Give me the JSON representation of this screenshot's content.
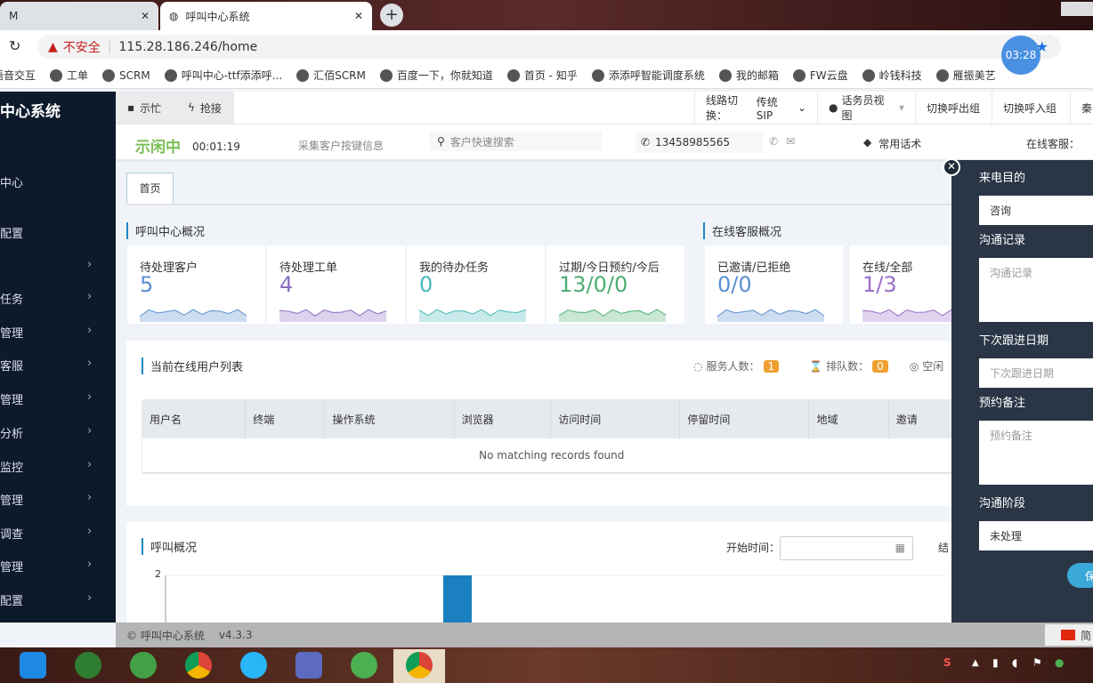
{
  "browser": {
    "tabs": [
      {
        "title": "M"
      },
      {
        "title": "呼叫中心系统"
      }
    ],
    "security": "不安全",
    "url": "115.28.186.246/home",
    "timer": "03:28",
    "bookmarks": [
      "语音交互",
      "工单",
      "SCRM",
      "呼叫中心-ttf添添呼...",
      "汇佰SCRM",
      "百度一下，你就知道",
      "首页 - 知乎",
      "添添呼智能调度系统",
      "我的邮箱",
      "FW云盘",
      "岭钱科技",
      "雁振美艺"
    ]
  },
  "sidebar": {
    "title": "中心系统",
    "items": [
      {
        "label": "中心",
        "chev": false
      },
      {
        "label": "配置",
        "chev": false
      },
      {
        "label": "",
        "chev": true
      },
      {
        "label": "任务",
        "chev": true
      },
      {
        "label": "管理",
        "chev": true
      },
      {
        "label": "客服",
        "chev": true
      },
      {
        "label": "管理",
        "chev": true
      },
      {
        "label": "分析",
        "chev": true
      },
      {
        "label": "监控",
        "chev": true
      },
      {
        "label": "管理",
        "chev": true
      },
      {
        "label": "调查",
        "chev": true
      },
      {
        "label": "管理",
        "chev": true
      },
      {
        "label": "配置",
        "chev": true
      }
    ]
  },
  "topbar": {
    "busy": "示忙",
    "grab": "抢接",
    "line_label": "线路切换：",
    "line_value": "传统SIP",
    "view": "话务员视图",
    "out_group": "切换呼出组",
    "in_group": "切换呼入组",
    "more": "秦"
  },
  "status": {
    "state": "示闲中",
    "duration": "00:01:19",
    "collect": "采集客户按键信息",
    "search_placeholder": "客户快速搜索",
    "phone": "13458985565",
    "scripts": "常用话术",
    "online_label": "在线客服："
  },
  "tabs": [
    "首页"
  ],
  "overview": {
    "title": "呼叫中心概况",
    "kpis": [
      {
        "label": "待处理客户",
        "value": "5",
        "color": "#5b8fd0"
      },
      {
        "label": "待处理工单",
        "value": "4",
        "color": "#8a6cc0"
      },
      {
        "label": "我的待办任务",
        "value": "0",
        "color": "#48b8b8"
      },
      {
        "label": "过期/今日预约/今后",
        "value": "13/0/0",
        "color": "#4caf70"
      }
    ]
  },
  "online_overview": {
    "title": "在线客服概况",
    "kpis": [
      {
        "label": "已邀请/已拒绝",
        "value": "0/0",
        "color": "#5b8fd0"
      },
      {
        "label": "在线/全部",
        "value": "1/3",
        "color": "#9a6cc8"
      }
    ]
  },
  "online_users": {
    "title": "当前在线用户列表",
    "serving_label": "服务人数：",
    "serving": "1",
    "queue_label": "排队数：",
    "queue": "0",
    "idle_label": "空闲",
    "columns": [
      "用户名",
      "终端",
      "操作系统",
      "浏览器",
      "访问时间",
      "停留时间",
      "地域",
      "邀请"
    ],
    "empty": "No matching records found"
  },
  "call_overview": {
    "title": "呼叫概况",
    "start_label": "开始时间：",
    "end_label": "结",
    "chart_data": {
      "type": "bar",
      "ytick": "2",
      "values": [
        2
      ]
    }
  },
  "panel": {
    "purpose_label": "来电目的",
    "purpose_value": "咨询",
    "record_label": "沟通记录",
    "record_placeholder": "沟通记录",
    "next_label": "下次跟进日期",
    "next_placeholder": "下次跟进日期",
    "note_label": "预约备注",
    "note_placeholder": "预约备注",
    "stage_label": "沟通阶段",
    "stage_value": "未处理",
    "save": "保"
  },
  "footer": {
    "copyright": "© 呼叫中心系统",
    "version": "v4.3.3",
    "lang": "简"
  }
}
